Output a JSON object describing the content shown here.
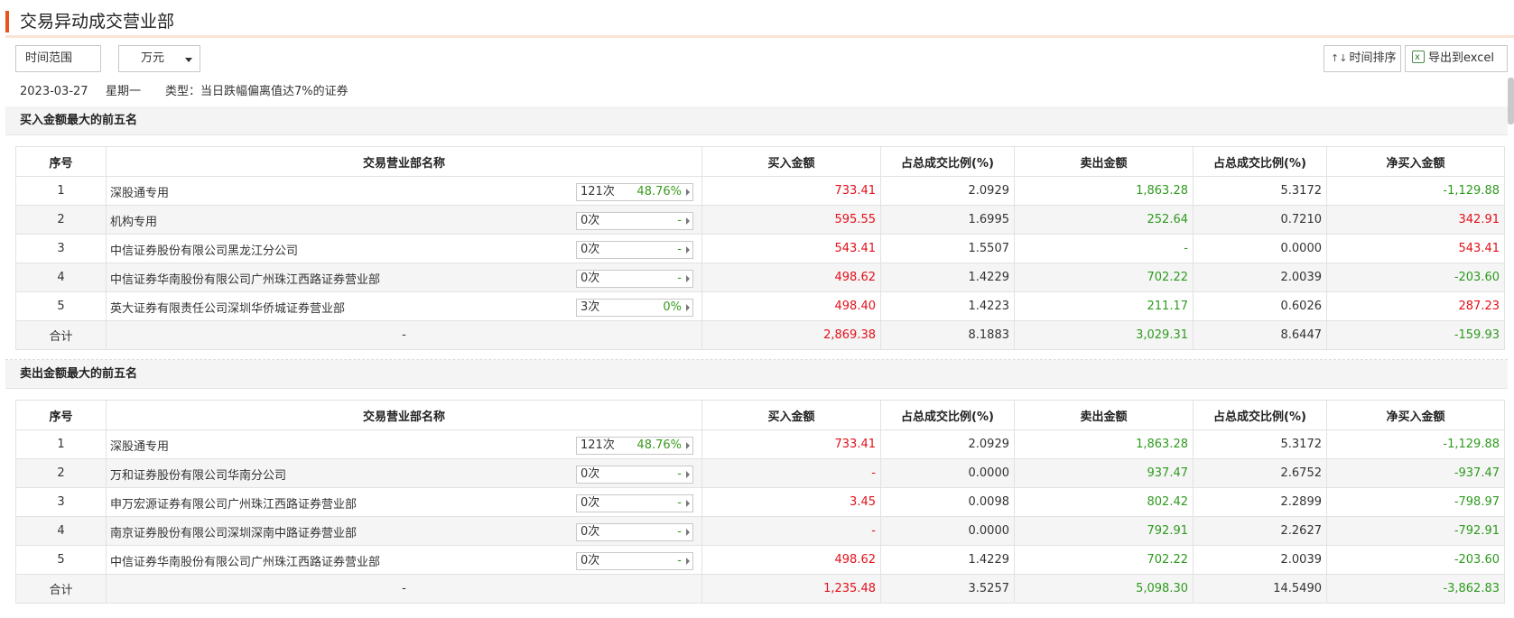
{
  "page": {
    "title": "交易异动成交营业部",
    "range_button": "时间范围",
    "unit_select": "万元",
    "sort_button": "时间排序",
    "export_button": "导出到excel",
    "date": "2023-03-27",
    "weekday": "星期一",
    "type_label": "类型：当日跌幅偏离值达7%的证券",
    "accent_color": "#e8541e"
  },
  "columns": [
    "序号",
    "交易营业部名称",
    "买入金额",
    "占总成交比例(%)",
    "卖出金额",
    "占总成交比例(%)",
    "净买入金额"
  ],
  "buy_top5": {
    "heading": "买入金额最大的前五名",
    "rows": [
      {
        "idx": "1",
        "name": "深股通专用",
        "times": "121次",
        "rate": "48.76%",
        "buy": "733.41",
        "buy_pct": "2.0929",
        "sell": "1,863.28",
        "sell_pct": "5.3172",
        "net": "-1,129.88"
      },
      {
        "idx": "2",
        "name": "机构专用",
        "times": "0次",
        "rate": "-",
        "buy": "595.55",
        "buy_pct": "1.6995",
        "sell": "252.64",
        "sell_pct": "0.7210",
        "net": "342.91"
      },
      {
        "idx": "3",
        "name": "中信证券股份有限公司黑龙江分公司",
        "times": "0次",
        "rate": "-",
        "buy": "543.41",
        "buy_pct": "1.5507",
        "sell": "-",
        "sell_pct": "0.0000",
        "net": "543.41"
      },
      {
        "idx": "4",
        "name": "中信证券华南股份有限公司广州珠江西路证券营业部",
        "times": "0次",
        "rate": "-",
        "buy": "498.62",
        "buy_pct": "1.4229",
        "sell": "702.22",
        "sell_pct": "2.0039",
        "net": "-203.60"
      },
      {
        "idx": "5",
        "name": "英大证券有限责任公司深圳华侨城证券营业部",
        "times": "3次",
        "rate": "0%",
        "buy": "498.40",
        "buy_pct": "1.4223",
        "sell": "211.17",
        "sell_pct": "0.6026",
        "net": "287.23"
      }
    ],
    "total": {
      "label": "合计",
      "name": "-",
      "buy": "2,869.38",
      "buy_pct": "8.1883",
      "sell": "3,029.31",
      "sell_pct": "8.6447",
      "net": "-159.93"
    }
  },
  "sell_top5": {
    "heading": "卖出金额最大的前五名",
    "rows": [
      {
        "idx": "1",
        "name": "深股通专用",
        "times": "121次",
        "rate": "48.76%",
        "buy": "733.41",
        "buy_pct": "2.0929",
        "sell": "1,863.28",
        "sell_pct": "5.3172",
        "net": "-1,129.88"
      },
      {
        "idx": "2",
        "name": "万和证券股份有限公司华南分公司",
        "times": "0次",
        "rate": "-",
        "buy": "-",
        "buy_pct": "0.0000",
        "sell": "937.47",
        "sell_pct": "2.6752",
        "net": "-937.47"
      },
      {
        "idx": "3",
        "name": "申万宏源证券有限公司广州珠江西路证券营业部",
        "times": "0次",
        "rate": "-",
        "buy": "3.45",
        "buy_pct": "0.0098",
        "sell": "802.42",
        "sell_pct": "2.2899",
        "net": "-798.97"
      },
      {
        "idx": "4",
        "name": "南京证券股份有限公司深圳深南中路证券营业部",
        "times": "0次",
        "rate": "-",
        "buy": "-",
        "buy_pct": "0.0000",
        "sell": "792.91",
        "sell_pct": "2.2627",
        "net": "-792.91"
      },
      {
        "idx": "5",
        "name": "中信证券华南股份有限公司广州珠江西路证券营业部",
        "times": "0次",
        "rate": "-",
        "buy": "498.62",
        "buy_pct": "1.4229",
        "sell": "702.22",
        "sell_pct": "2.0039",
        "net": "-203.60"
      }
    ],
    "total": {
      "label": "合计",
      "name": "-",
      "buy": "1,235.48",
      "buy_pct": "3.5257",
      "sell": "5,098.30",
      "sell_pct": "14.5490",
      "net": "-3,862.83"
    }
  }
}
